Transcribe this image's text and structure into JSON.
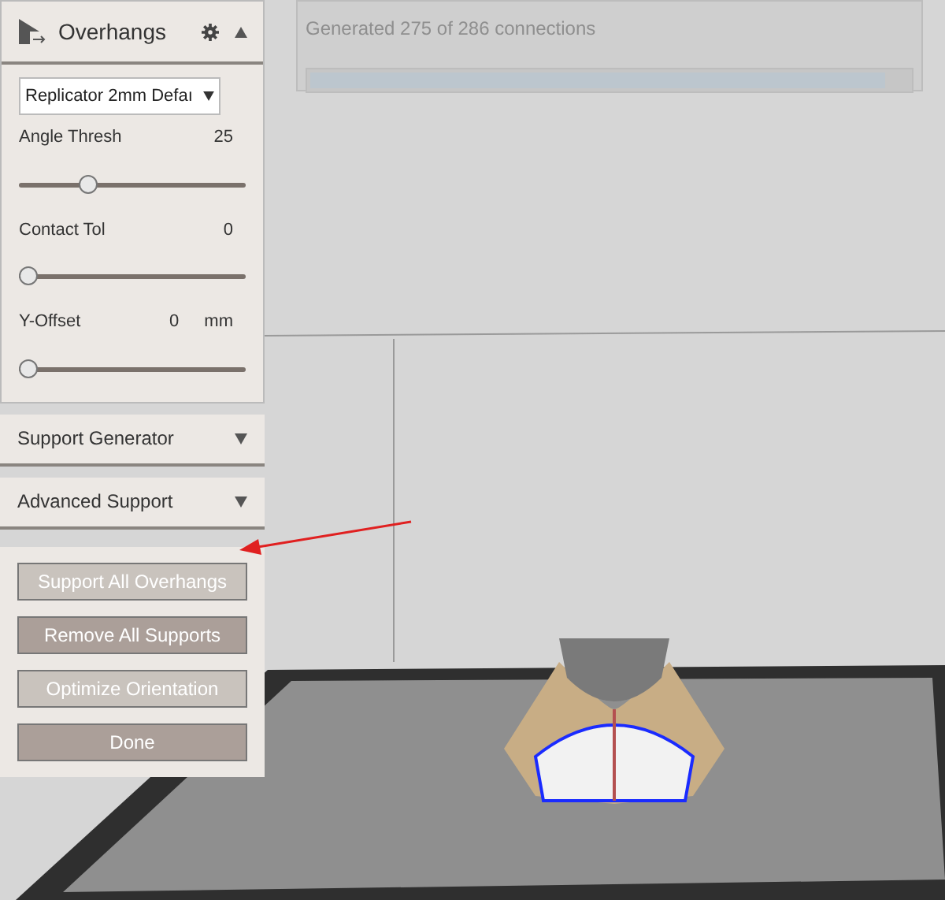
{
  "progress_dialog": {
    "message": "Generated 275 of 286 connections",
    "level": 0.96
  },
  "overhangs_panel": {
    "title": "Overhangs",
    "expanded": true,
    "profile": "Replicator 2mm Defaı",
    "sliders": [
      {
        "label": "Angle Thresh",
        "value": "25",
        "level": 0.29
      },
      {
        "label": "Contact Tol",
        "value": "0",
        "level": 0
      },
      {
        "label": "Y-Offset",
        "value": "0",
        "unit": "mm",
        "level": 0
      }
    ]
  },
  "collapsed_sections": [
    {
      "title": "Support Generator",
      "expanded": false
    },
    {
      "title": "Advanced Support",
      "expanded": false
    }
  ],
  "actions": [
    {
      "label": "Support All Overhangs",
      "kind": "light"
    },
    {
      "label": "Remove All Supports",
      "kind": "dark"
    },
    {
      "label": "Optimize Orientation",
      "kind": "light"
    },
    {
      "label": "Done",
      "kind": "dark"
    }
  ]
}
